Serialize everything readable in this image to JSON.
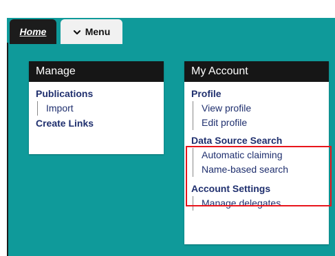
{
  "tabs": {
    "home": "Home",
    "menu": "Menu"
  },
  "manage": {
    "header": "Manage",
    "publications": "Publications",
    "import": "Import",
    "create_links": "Create Links"
  },
  "account": {
    "header": "My Account",
    "profile": "Profile",
    "view_profile": "View profile",
    "edit_profile": "Edit profile",
    "data_source_search": "Data Source Search",
    "automatic_claiming": "Automatic claiming",
    "name_based_search": "Name-based search",
    "account_settings": "Account Settings",
    "manage_delegates": "Manage delegates"
  },
  "colors": {
    "teal": "#0f9a9a",
    "header_bg": "#161616",
    "link": "#1f2f6e",
    "highlight": "#e8141b"
  },
  "icons": {
    "menu_chevron": "chevron-down-icon"
  }
}
